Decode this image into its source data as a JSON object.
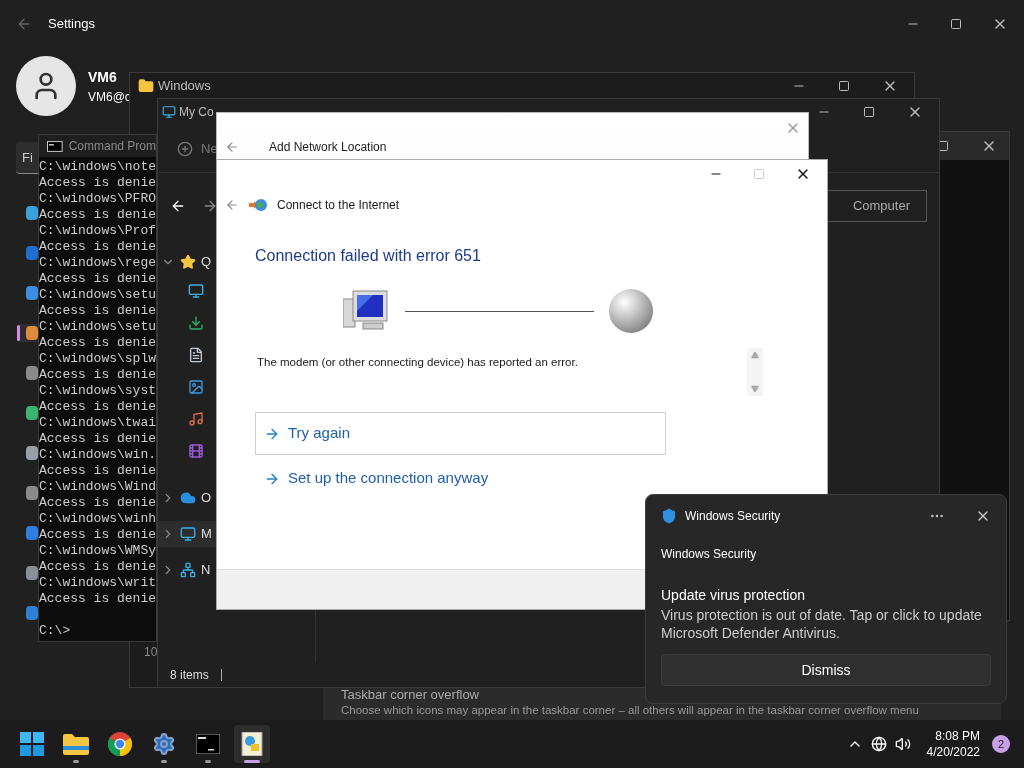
{
  "settings": {
    "title": "Settings",
    "user": {
      "name": "VM6",
      "email": "VM6@c"
    },
    "search": {
      "placeholder": "Fi"
    },
    "nav": [
      {
        "color": "#3aa0d8",
        "selected": false
      },
      {
        "color": "#1f6fd1",
        "selected": false
      },
      {
        "color": "#3c8fe0",
        "selected": false
      },
      {
        "color": "#e08a3c",
        "selected": true
      },
      {
        "color": "#8a8a8a",
        "selected": false
      },
      {
        "color": "#3cb371",
        "selected": false
      },
      {
        "color": "#9aa0a6",
        "selected": false
      },
      {
        "color": "#8a8a8a",
        "selected": false
      },
      {
        "color": "#2f7fe0",
        "selected": false
      },
      {
        "color": "#8a8f96",
        "selected": false
      },
      {
        "color": "#2e7fd6",
        "selected": false
      }
    ],
    "row": {
      "title": "Taskbar corner overflow",
      "description": "Choose which icons may appear in the taskbar corner – all others will appear in the taskbar corner overflow menu"
    }
  },
  "explorer": {
    "title": "Windows",
    "fragment": "10"
  },
  "my_computer": {
    "title": "My Co",
    "new_label": "Ne",
    "computer_button": "Computer",
    "status": "8 items",
    "tree": [
      {
        "kind": "quick",
        "label": "Q",
        "expanded": true,
        "selected": false
      },
      {
        "kind": "cloud",
        "label": "O",
        "expanded": false,
        "selected": false
      },
      {
        "kind": "pc",
        "label": "M",
        "expanded": false,
        "selected": true
      },
      {
        "kind": "network",
        "label": "N",
        "expanded": false,
        "selected": false
      }
    ]
  },
  "command_prompt": {
    "title": "Command Prom",
    "lines": [
      "C:\\windows\\note",
      "Access is denie",
      "C:\\windows\\PFRO",
      "Access is denie",
      "C:\\windows\\Prof",
      "Access is denie",
      "C:\\windows\\rege",
      "Access is denie",
      "C:\\windows\\setu",
      "Access is denie",
      "C:\\windows\\setu",
      "Access is denie",
      "C:\\windows\\splw",
      "Access is denie",
      "C:\\windows\\syst",
      "Access is denie",
      "C:\\windows\\twai",
      "Access is denie",
      "C:\\windows\\win.",
      "Access is denie",
      "C:\\windows\\Wind",
      "Access is denie",
      "C:\\windows\\winh",
      "Access is denie",
      "C:\\windows\\WMSy",
      "Access is denie",
      "C:\\windows\\writ",
      "Access is denie"
    ],
    "prompt": "C:\\>"
  },
  "wizard": {
    "title": "Add Network Location"
  },
  "connect_dialog": {
    "title": "Connect to the Internet",
    "heading": "Connection failed with error 651",
    "message": "The modem (or other connecting device) has reported an error.",
    "maximize_disabled": true,
    "options": [
      {
        "label": "Try again",
        "selected": true
      },
      {
        "label": "Set up the connection anyway",
        "selected": false
      }
    ]
  },
  "notification": {
    "app": "Windows Security",
    "source": "Windows Security",
    "title": "Update virus protection",
    "body": "Virus protection is out of date. Tap or click to update Microsoft Defender Antivirus.",
    "button": "Dismiss"
  },
  "taskbar": {
    "apps": [
      {
        "kind": "start",
        "running": false,
        "active": false
      },
      {
        "kind": "explorer",
        "running": true,
        "active": false
      },
      {
        "kind": "chrome",
        "running": false,
        "active": false
      },
      {
        "kind": "settings",
        "running": true,
        "active": false
      },
      {
        "kind": "terminal",
        "running": true,
        "active": false
      },
      {
        "kind": "network",
        "running": true,
        "active": true
      }
    ],
    "tray": {
      "time": "8:08 PM",
      "date": "4/20/2022",
      "badge": "2"
    }
  }
}
